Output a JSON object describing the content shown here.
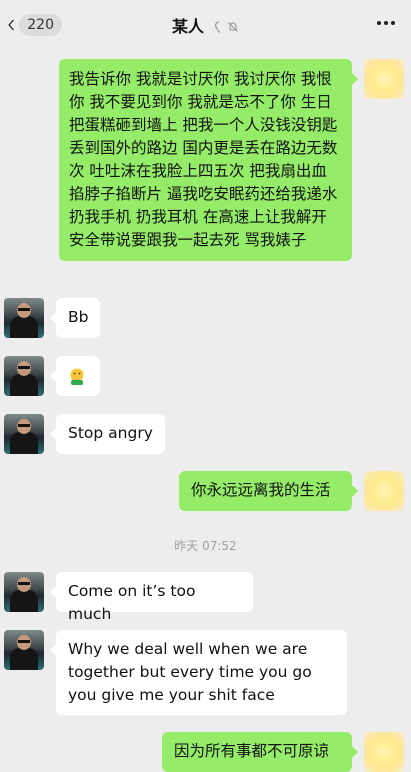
{
  "header": {
    "back_count": "220",
    "title": "某人"
  },
  "timestamp": "昨天 07:52",
  "messages": [
    {
      "side": "right",
      "text": "我告诉你 我就是讨厌你 我讨厌你 我恨你 我不要见到你  我就是忘不了你 生日把蛋糕砸到墙上 把我一个人没钱没钥匙丢到国外的路边 国内更是丢在路边无数次 吐吐沫在我脸上四五次 把我扇出血 掐脖子掐断片 逼我吃安眠药还给我递水 扔我手机 扔我耳机 在高速上让我解开安全带说要跟我一起去死 骂我婊子"
    },
    {
      "side": "left",
      "text": "Bb"
    },
    {
      "side": "left",
      "text": "",
      "emoji": "face-with-mask-emoji"
    },
    {
      "side": "left",
      "text": "Stop angry"
    },
    {
      "side": "right",
      "text": "你永远远离我的生活"
    },
    {
      "side": "left",
      "text": "Come on it’s too much"
    },
    {
      "side": "left",
      "text": "Why we deal well when we are together but every time you go you give me your shit face"
    },
    {
      "side": "right",
      "text": "因为所有事都不可原谅"
    }
  ]
}
